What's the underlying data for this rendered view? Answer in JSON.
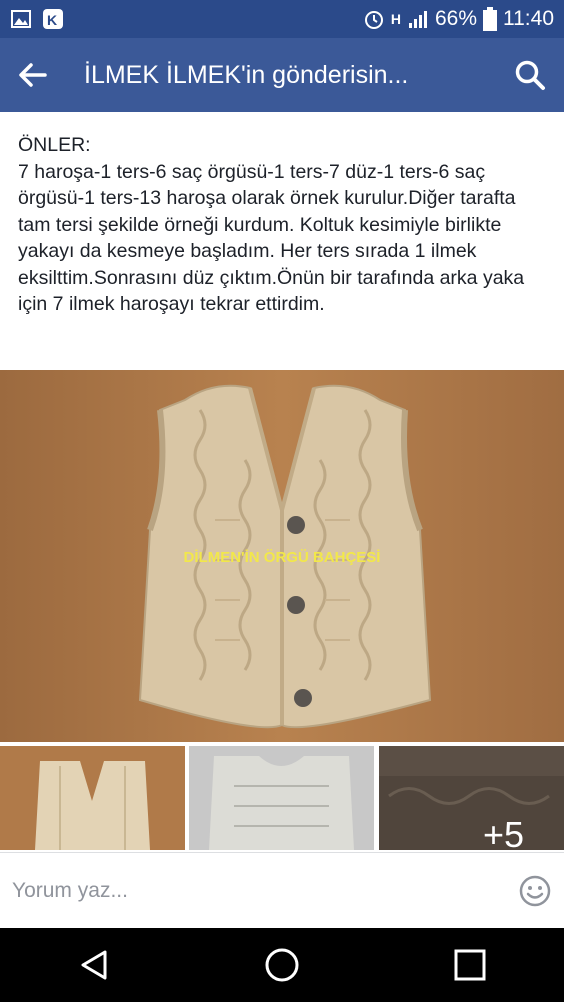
{
  "status_bar": {
    "battery": "66%",
    "time": "11:40",
    "network": "H"
  },
  "app_bar": {
    "title": "İLMEK İLMEK'in gönderisin..."
  },
  "post": {
    "text": "ÖNLER:\n7 haroşa-1 ters-6 saç örgüsü-1 ters-7 düz-1 ters-6 saç örgüsü-1 ters-13 haroşa olarak örnek kurulur.Diğer tarafta tam tersi şekilde örneği kurdum. Koltuk kesimiyle birlikte yakayı da kesmeye başladım. Her ters sırada 1 ilmek eksilttim.Sonrasını düz çıktım.Önün bir tarafında arka yaka için 7 ilmek haroşayı tekrar ettirdim.",
    "watermark": "DİLMEN'İN ÖRGÜ BAHÇESİ",
    "more_photos": "+5"
  },
  "comment": {
    "placeholder": "Yorum yaz..."
  },
  "colors": {
    "status_bar": "#2b4a8a",
    "app_bar": "#3b5998",
    "background_wood": "#b07a49",
    "knit": "#d9c6a5"
  }
}
